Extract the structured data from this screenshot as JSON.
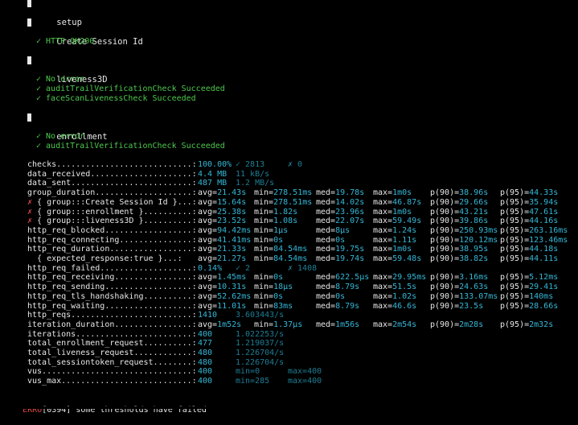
{
  "groups": [
    {
      "title": "setup",
      "checks": []
    },
    {
      "title": "Create Session Id",
      "checks": [
        "✓ HTTP OK200"
      ]
    },
    {
      "title": "liveness3D",
      "checks": [
        "✓ No error",
        "✓ auditTrailVerificationCheck Succeeded",
        "✓ faceScanLivenessCheck Succeeded"
      ]
    },
    {
      "title": "enrollment",
      "checks": [
        "✓ No error",
        "✓ auditTrailVerificationCheck Succeeded"
      ]
    }
  ],
  "metrics": [
    {
      "name": "checks",
      "dots": "............................:",
      "prefix": "",
      "cells": [
        {
          "t": "100.00%",
          "c": "c"
        },
        {
          "t": "✓ 2813",
          "c": "d"
        },
        {
          "t": "✗ 0",
          "c": "d"
        }
      ]
    },
    {
      "name": "data_received",
      "dots": ".....................:",
      "prefix": "",
      "cells": [
        {
          "t": "4.4 MB",
          "c": "c"
        },
        {
          "t": "11 kB/s",
          "c": "d"
        }
      ]
    },
    {
      "name": "data_sent",
      "dots": ".........................:",
      "prefix": "",
      "cells": [
        {
          "t": "487 MB",
          "c": "c"
        },
        {
          "t": "1.2 MB/s",
          "c": "d"
        }
      ]
    },
    {
      "name": "group_duration",
      "dots": "....................:",
      "prefix": "",
      "cells": [
        {
          "t": "avg=21.43s"
        },
        {
          "t": "min=278.51ms"
        },
        {
          "t": "med=19.78s"
        },
        {
          "t": "max=1m0s"
        },
        {
          "t": "p(90)=38.96s"
        },
        {
          "t": "p(95)=44.33s"
        }
      ]
    },
    {
      "name": "{ group:::Create Session Id }",
      "dots": "...:",
      "prefix": "✗ ",
      "cells": [
        {
          "t": "avg=15.64s"
        },
        {
          "t": "min=278.51ms"
        },
        {
          "t": "med=14.02s"
        },
        {
          "t": "max=46.87s"
        },
        {
          "t": "p(90)=29.66s"
        },
        {
          "t": "p(95)=35.94s"
        }
      ]
    },
    {
      "name": "{ group:::enrollment }",
      "dots": "..........:",
      "prefix": "✗ ",
      "cells": [
        {
          "t": "avg=25.38s"
        },
        {
          "t": "min=1.82s"
        },
        {
          "t": "med=23.96s"
        },
        {
          "t": "max=1m0s"
        },
        {
          "t": "p(90)=43.21s"
        },
        {
          "t": "p(95)=47.61s"
        }
      ]
    },
    {
      "name": "{ group:::liveness3D }",
      "dots": "..........:",
      "prefix": "✗ ",
      "cells": [
        {
          "t": "avg=23.52s"
        },
        {
          "t": "min=1.08s"
        },
        {
          "t": "med=22.07s"
        },
        {
          "t": "max=59.49s"
        },
        {
          "t": "p(90)=39.86s"
        },
        {
          "t": "p(95)=44.16s"
        }
      ]
    },
    {
      "name": "http_req_blocked",
      "dots": "..................:",
      "prefix": "",
      "cells": [
        {
          "t": "avg=94.42ms"
        },
        {
          "t": "min=1µs"
        },
        {
          "t": "med=8µs"
        },
        {
          "t": "max=1.24s"
        },
        {
          "t": "p(90)=250.93ms"
        },
        {
          "t": "p(95)=263.16ms"
        }
      ]
    },
    {
      "name": "http_req_connecting",
      "dots": "...............:",
      "prefix": "",
      "cells": [
        {
          "t": "avg=41.41ms"
        },
        {
          "t": "min=0s"
        },
        {
          "t": "med=0s"
        },
        {
          "t": "max=1.11s"
        },
        {
          "t": "p(90)=120.12ms"
        },
        {
          "t": "p(95)=123.46ms"
        }
      ]
    },
    {
      "name": "http_req_duration",
      "dots": ".................:",
      "prefix": "",
      "cells": [
        {
          "t": "avg=21.33s"
        },
        {
          "t": "min=84.54ms"
        },
        {
          "t": "med=19.75s"
        },
        {
          "t": "max=1m0s"
        },
        {
          "t": "p(90)=38.95s"
        },
        {
          "t": "p(95)=44.18s"
        }
      ]
    },
    {
      "name": "  { expected_response:true }",
      "dots": "...:",
      "prefix": "",
      "cells": [
        {
          "t": "avg=21.27s"
        },
        {
          "t": "min=84.54ms"
        },
        {
          "t": "med=19.74s"
        },
        {
          "t": "max=59.48s"
        },
        {
          "t": "p(90)=38.82s"
        },
        {
          "t": "p(95)=44.11s"
        }
      ]
    },
    {
      "name": "http_req_failed",
      "dots": "...................:",
      "prefix": "",
      "cells": [
        {
          "t": "0.14%",
          "c": "c"
        },
        {
          "t": "✓ 2",
          "c": "d"
        },
        {
          "t": "✗ 1408",
          "c": "d"
        }
      ]
    },
    {
      "name": "http_req_receiving",
      "dots": "................:",
      "prefix": "",
      "cells": [
        {
          "t": "avg=1.45ms"
        },
        {
          "t": "min=0s"
        },
        {
          "t": "med=622.5µs"
        },
        {
          "t": "max=29.95ms"
        },
        {
          "t": "p(90)=3.16ms"
        },
        {
          "t": "p(95)=5.12ms"
        }
      ]
    },
    {
      "name": "http_req_sending",
      "dots": "..................:",
      "prefix": "",
      "cells": [
        {
          "t": "avg=10.31s"
        },
        {
          "t": "min=18µs"
        },
        {
          "t": "med=8.79s"
        },
        {
          "t": "max=51.5s"
        },
        {
          "t": "p(90)=24.63s"
        },
        {
          "t": "p(95)=29.41s"
        }
      ]
    },
    {
      "name": "http_req_tls_handshaking",
      "dots": "..........:",
      "prefix": "",
      "cells": [
        {
          "t": "avg=52.62ms"
        },
        {
          "t": "min=0s"
        },
        {
          "t": "med=0s"
        },
        {
          "t": "max=1.02s"
        },
        {
          "t": "p(90)=133.07ms"
        },
        {
          "t": "p(95)=140ms"
        }
      ]
    },
    {
      "name": "http_req_waiting",
      "dots": "..................:",
      "prefix": "",
      "cells": [
        {
          "t": "avg=11.01s"
        },
        {
          "t": "min=83ms"
        },
        {
          "t": "med=8.79s"
        },
        {
          "t": "max=46.6s"
        },
        {
          "t": "p(90)=23.5s"
        },
        {
          "t": "p(95)=28.66s"
        }
      ]
    },
    {
      "name": "http_reqs",
      "dots": ".........................:",
      "prefix": "",
      "cells": [
        {
          "t": "1410",
          "c": "c"
        },
        {
          "t": "3.603443/s",
          "c": "d"
        }
      ]
    },
    {
      "name": "iteration_duration",
      "dots": "................:",
      "prefix": "",
      "cells": [
        {
          "t": "avg=1m52s"
        },
        {
          "t": "min=1.37µs"
        },
        {
          "t": "med=1m56s"
        },
        {
          "t": "max=2m54s"
        },
        {
          "t": "p(90)=2m28s"
        },
        {
          "t": "p(95)=2m32s"
        }
      ]
    },
    {
      "name": "iterations",
      "dots": "........................:",
      "prefix": "",
      "cells": [
        {
          "t": "400",
          "c": "c"
        },
        {
          "t": "1.022253/s",
          "c": "d"
        }
      ]
    },
    {
      "name": "total_enrollment_request",
      "dots": "..........:",
      "prefix": "",
      "cells": [
        {
          "t": "477",
          "c": "c"
        },
        {
          "t": "1.219037/s",
          "c": "d"
        }
      ]
    },
    {
      "name": "total_liveness_request",
      "dots": "............:",
      "prefix": "",
      "cells": [
        {
          "t": "480",
          "c": "c"
        },
        {
          "t": "1.226704/s",
          "c": "d"
        }
      ]
    },
    {
      "name": "total_sessiontoken_request",
      "dots": "........:",
      "prefix": "",
      "cells": [
        {
          "t": "480",
          "c": "c"
        },
        {
          "t": "1.226704/s",
          "c": "d"
        }
      ]
    },
    {
      "name": "vus",
      "dots": "...............................:",
      "prefix": "",
      "cells": [
        {
          "t": "400",
          "c": "c"
        },
        {
          "t": "min=0",
          "c": "d"
        },
        {
          "t": "max=400",
          "c": "d"
        }
      ]
    },
    {
      "name": "vus_max",
      "dots": "...........................:",
      "prefix": "",
      "cells": [
        {
          "t": "400",
          "c": "c"
        },
        {
          "t": "min=285",
          "c": "d"
        },
        {
          "t": "max=400",
          "c": "d"
        }
      ]
    }
  ],
  "error_line": {
    "level": "ERRO",
    "code": "[0394]",
    "message": "some thresholds have failed"
  },
  "colors": {
    "background": "#000000",
    "text": "#e8e8e8",
    "success": "#4ec94e",
    "value": "#34b7d6",
    "secondary_value": "#1f7d94",
    "error": "#e5484d"
  }
}
